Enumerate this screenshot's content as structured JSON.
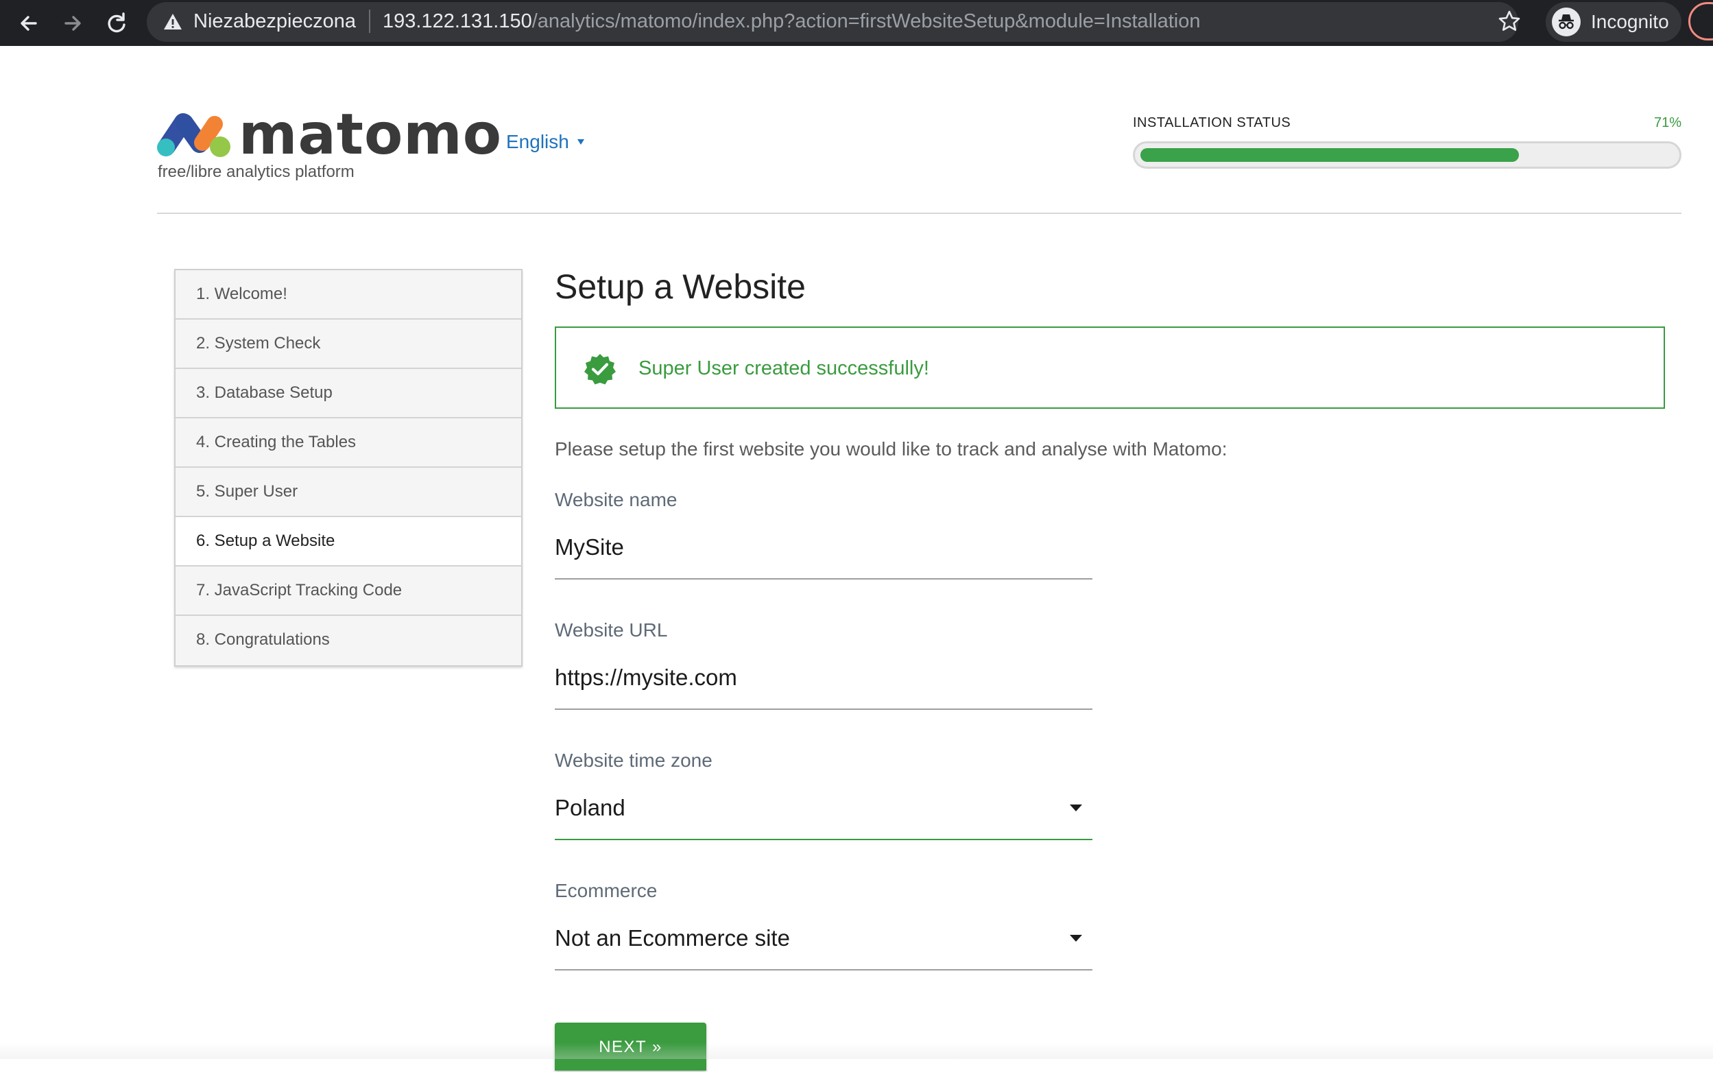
{
  "browser": {
    "security_label": "Niezabezpieczona",
    "url_host": "193.122.131.150",
    "url_path": "/analytics/matomo/index.php?action=firstWebsiteSetup&module=Installation",
    "profile_label": "Incognito",
    "icons": [
      "back-arrow-icon",
      "forward-arrow-icon",
      "reload-icon",
      "warning-triangle-icon",
      "bookmark-star-icon",
      "incognito-icon"
    ]
  },
  "header": {
    "logo_text": "matomo",
    "tagline": "free/libre analytics platform",
    "language": "English",
    "install_status_label": "INSTALLATION STATUS",
    "install_percent_label": "71%",
    "install_progress": 0.71
  },
  "steps": [
    {
      "label": "1. Welcome!"
    },
    {
      "label": "2. System Check"
    },
    {
      "label": "3. Database Setup"
    },
    {
      "label": "4. Creating the Tables"
    },
    {
      "label": "5. Super User"
    },
    {
      "label": "6. Setup a Website",
      "current": true
    },
    {
      "label": "7. JavaScript Tracking Code"
    },
    {
      "label": "8. Congratulations"
    }
  ],
  "main": {
    "title": "Setup a Website",
    "alert": "Super User created successfully!",
    "intro": "Please setup the first website you would like to track and analyse with Matomo:",
    "fields": {
      "website_name": {
        "label": "Website name",
        "value": "MySite"
      },
      "website_url": {
        "label": "Website URL",
        "value": "https://mysite.com"
      },
      "timezone": {
        "label": "Website time zone",
        "value": "Poland"
      },
      "ecommerce": {
        "label": "Ecommerce",
        "value": "Not an Ecommerce site"
      }
    },
    "next_label": "NEXT »"
  },
  "colors": {
    "chrome_bg": "#202124",
    "accent_green": "#3a9b3f",
    "link_blue": "#1e73be",
    "logo_blue": "#3450a3",
    "logo_teal": "#35bfc0",
    "logo_green": "#95c748",
    "logo_red": "#f38334"
  }
}
